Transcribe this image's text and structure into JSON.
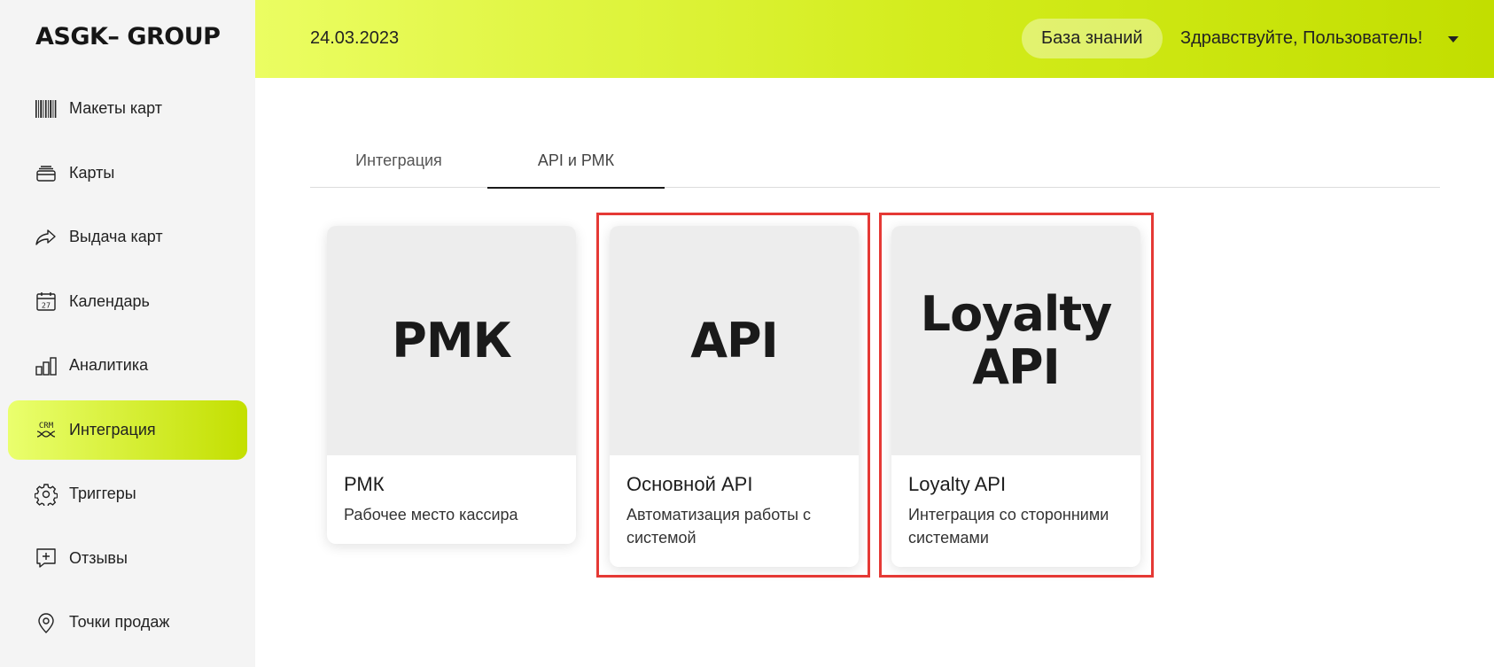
{
  "logo": "ASGK– GROUP",
  "sidebar": {
    "items": [
      {
        "label": "Макеты карт",
        "icon": "barcode-icon",
        "active": false
      },
      {
        "label": "Карты",
        "icon": "cards-stack-icon",
        "active": false
      },
      {
        "label": "Выдача карт",
        "icon": "share-arrow-icon",
        "active": false
      },
      {
        "label": "Календарь",
        "icon": "calendar-icon",
        "active": false
      },
      {
        "label": "Аналитика",
        "icon": "bar-chart-icon",
        "active": false
      },
      {
        "label": "Интеграция",
        "icon": "crm-icon",
        "active": true
      },
      {
        "label": "Триггеры",
        "icon": "gear-icon",
        "active": false
      },
      {
        "label": "Отзывы",
        "icon": "add-comment-icon",
        "active": false
      },
      {
        "label": "Точки продаж",
        "icon": "map-pin-icon",
        "active": false
      }
    ]
  },
  "header": {
    "date": "24.03.2023",
    "knowledge_base": "База знаний",
    "greeting": "Здравствуйте, Пользователь!"
  },
  "tabs": [
    {
      "label": "Интеграция",
      "active": false
    },
    {
      "label": "API и РМК",
      "active": true
    }
  ],
  "cards": [
    {
      "cover": "РМК",
      "title": "РМК",
      "description": "Рабочее место кассира",
      "highlighted": false
    },
    {
      "cover": "API",
      "title": "Основной API",
      "description": "Автоматизация работы с системой",
      "highlighted": true
    },
    {
      "cover": "Loyalty API",
      "title": "Loyalty API",
      "description": "Интеграция со сторонними системами",
      "highlighted": true
    }
  ],
  "colors": {
    "accent_light": "#eaff6e",
    "accent_dark": "#c2de00",
    "highlight": "#e53935",
    "sidebar_bg": "#f4f4f4"
  }
}
